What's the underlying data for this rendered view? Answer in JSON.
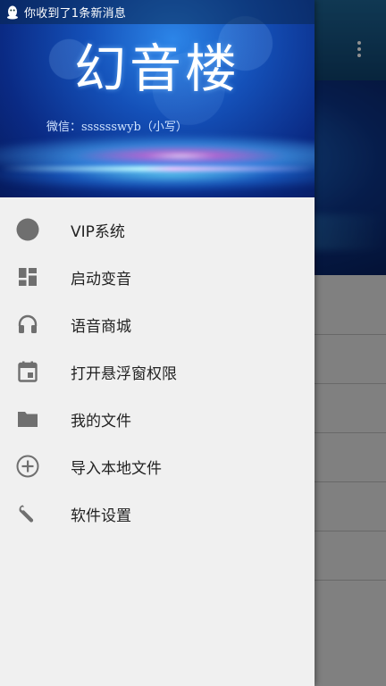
{
  "status_bar": {
    "notification_text": "你收到了1条新消息",
    "app_icon": "qq-penguin-icon"
  },
  "header": {
    "title": "幻音楼",
    "wechat": "微信：sssssswyb（小写）"
  },
  "menu": {
    "items": [
      {
        "label": "VIP系统",
        "icon": "circle-icon"
      },
      {
        "label": "启动变音",
        "icon": "dashboard-icon"
      },
      {
        "label": "语音商城",
        "icon": "headphones-icon"
      },
      {
        "label": "打开悬浮窗权限",
        "icon": "calendar-icon"
      },
      {
        "label": "我的文件",
        "icon": "folder-icon"
      },
      {
        "label": "导入本地文件",
        "icon": "add-circle-icon"
      },
      {
        "label": "软件设置",
        "icon": "wrench-icon"
      }
    ]
  },
  "background_app": {
    "toolbar_menu_icon": "overflow-menu-icon"
  },
  "colors": {
    "drawer_bg": "#f0f0f0",
    "icon_gray": "#6f6f6f",
    "header_blue": "#1450b8"
  }
}
